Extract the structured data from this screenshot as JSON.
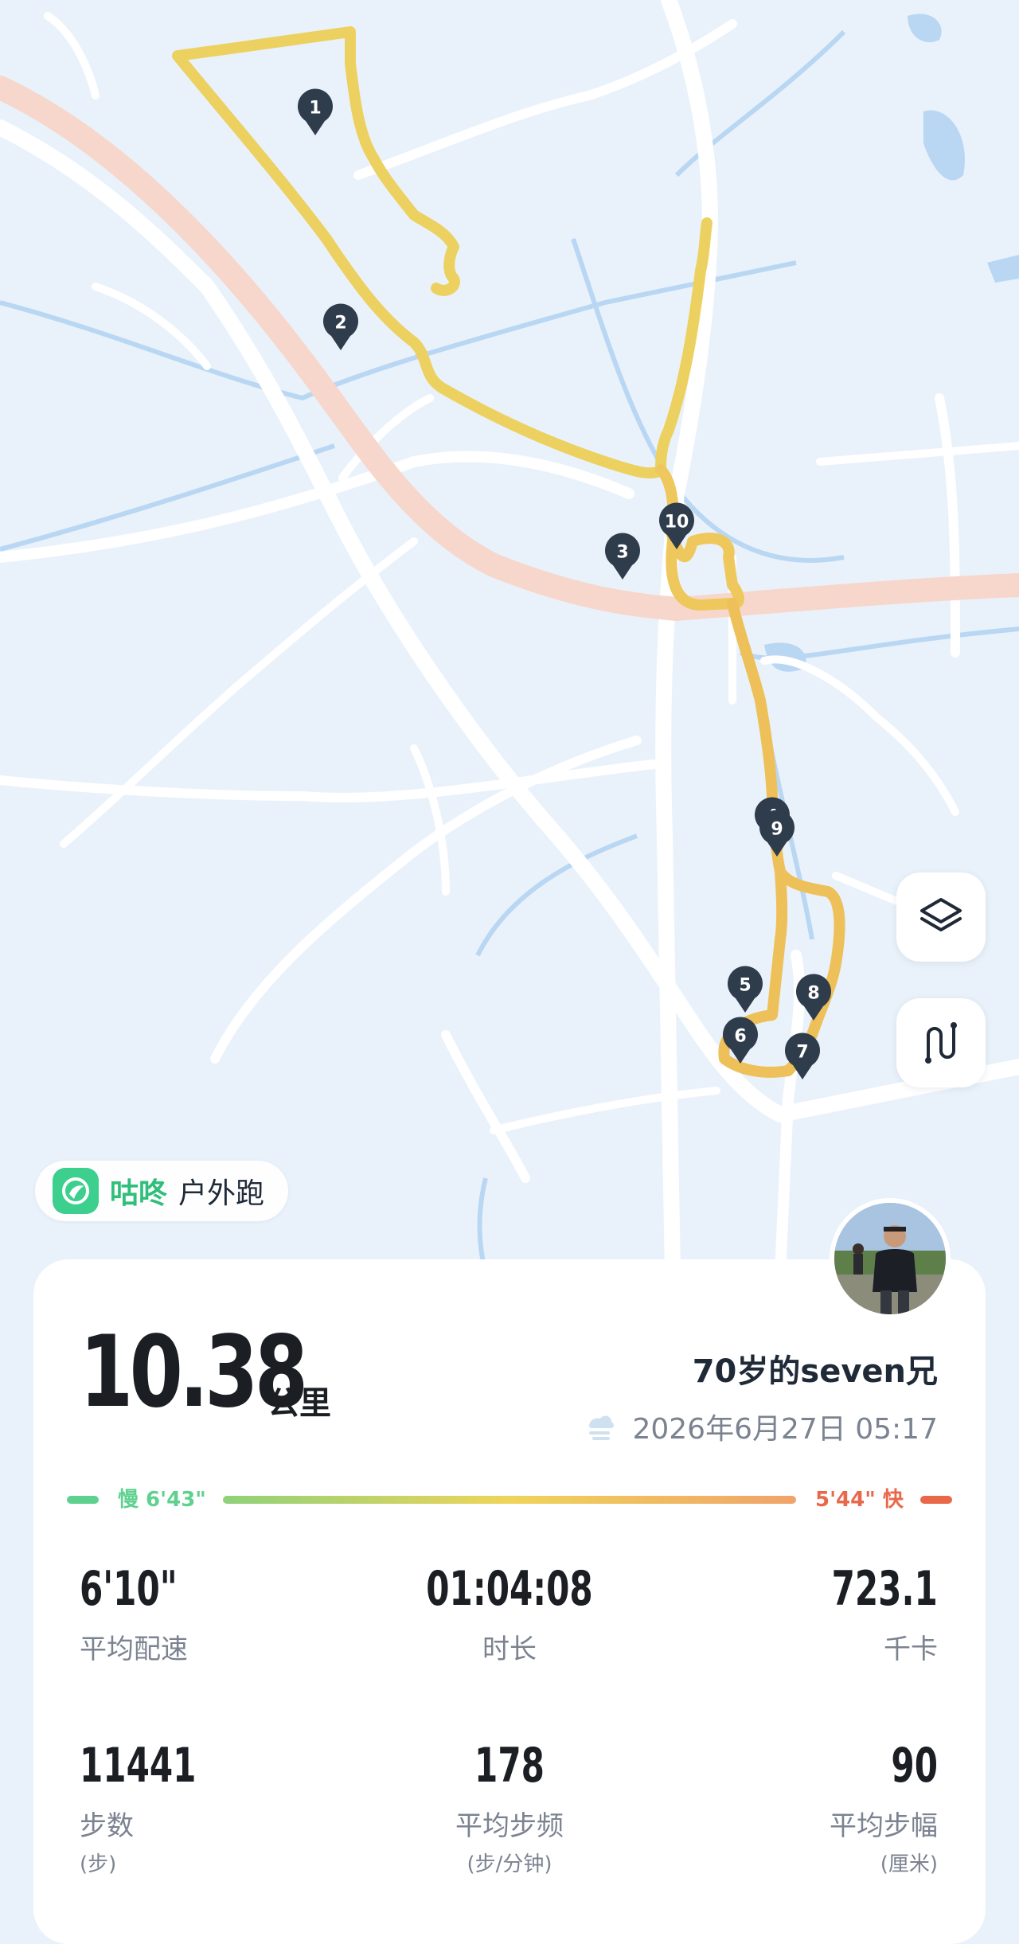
{
  "map": {
    "markers": [
      {
        "label": "1"
      },
      {
        "label": "2"
      },
      {
        "label": "3"
      },
      {
        "label": "4"
      },
      {
        "label": "5"
      },
      {
        "label": "6"
      },
      {
        "label": "7"
      },
      {
        "label": "8"
      },
      {
        "label": "9"
      },
      {
        "label": "10"
      }
    ],
    "layers_icon": "layers-icon",
    "route_icon": "route-icon"
  },
  "brand": {
    "name": "咕咚",
    "mode": "户外跑",
    "logo_icon": "codoon-bird-icon"
  },
  "summary": {
    "distance": "10.38",
    "distance_unit": "公里",
    "user_name": "70岁的seven兄",
    "weather_icon": "cloudy-icon",
    "datetime": "2026年6月27日 05:17"
  },
  "pace": {
    "slow_label": "慢 6'43\"",
    "fast_label": "5'44\" 快",
    "slow_color": "#5fd18f",
    "fast_color": "#e9684a"
  },
  "stats": [
    {
      "value": "6'10\"",
      "label": "平均配速",
      "unit": ""
    },
    {
      "value": "01:04:08",
      "label": "时长",
      "unit": ""
    },
    {
      "value": "723.1",
      "label": "千卡",
      "unit": ""
    },
    {
      "value": "11441",
      "label": "步数",
      "unit": "(步)"
    },
    {
      "value": "178",
      "label": "平均步频",
      "unit": "(步/分钟)"
    },
    {
      "value": "90",
      "label": "平均步幅",
      "unit": "(厘米)"
    }
  ]
}
